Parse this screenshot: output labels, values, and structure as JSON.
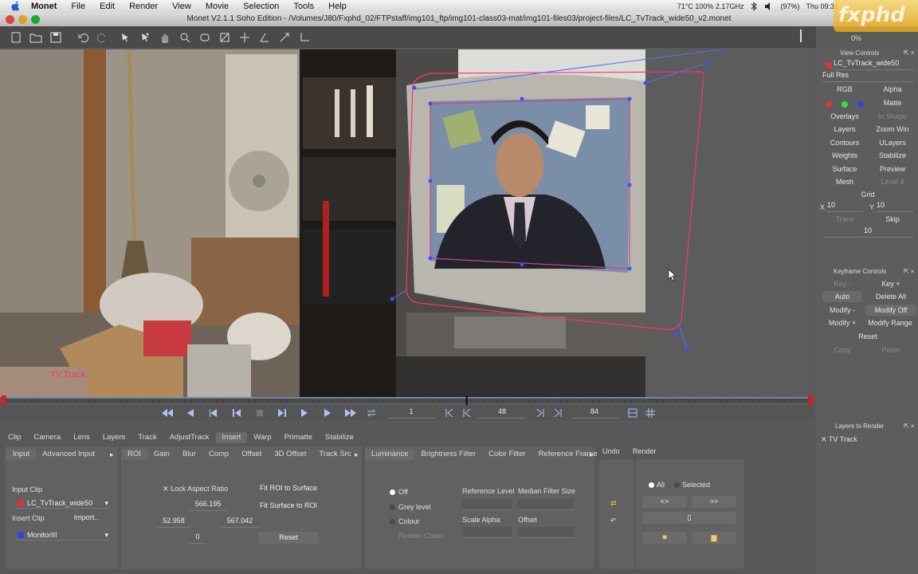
{
  "menubar": {
    "items": [
      "Monet",
      "File",
      "Edit",
      "Render",
      "View",
      "Movie",
      "Selection",
      "Tools",
      "Help"
    ],
    "status": "71°C 100% 2.17GHz",
    "battery": "(97%)",
    "clock": "Thu 09:31"
  },
  "window": {
    "title": "Monet V2.1.1 Soho Edition - /Volumes/J80/Fxphd_02/FTPstaff/img101_ftp/img101-class03-mat/img101-files03/project-files/LC_TvTrack_wide50_v2.monet",
    "watermark": "fxphd"
  },
  "toolbar": {
    "progress_label": "0%",
    "progress_value": 0
  },
  "viewer": {
    "layer_label": "TV Track",
    "accent_spline": "#ff3366",
    "accent_points": "#3355ff"
  },
  "view_controls": {
    "header": "View Controls",
    "clip": "LC_TvTrack_wide50",
    "resolution": "Full Res",
    "rgb": "RGB",
    "alpha": "Alpha",
    "matte": "Matte",
    "overlays": "Overlays",
    "in_shape": "In Shape",
    "layers": "Layers",
    "zoom_win": "Zoom Win",
    "contours": "Contours",
    "ulayers": "ULayers",
    "weights": "Weights",
    "stabilize": "Stabilize",
    "surface": "Surface",
    "preview": "Preview",
    "mesh": "Mesh",
    "level": "Level 4",
    "grid": "Grid",
    "grid_x_label": "X",
    "grid_x": "10",
    "grid_y_label": "Y",
    "grid_y": "10",
    "trace": "Trace",
    "skip": "Skip",
    "skip_value": "10"
  },
  "keyframe_controls": {
    "header": "Keyframe Controls",
    "key_minus": "Key -",
    "key_plus": "Key +",
    "auto": "Auto",
    "delete_all": "Delete All",
    "modify_minus": "Modify -",
    "modify_off": "Modify Off",
    "modify_plus": "Modify +",
    "modify_range": "Modify Range",
    "reset": "Reset",
    "copy": "Copy",
    "paste": "Paste"
  },
  "layers_to_render": {
    "header": "Layers to Render",
    "items": [
      "TV Track"
    ]
  },
  "transport": {
    "start_frame": "1",
    "current_frame": "48",
    "end_frame": "84",
    "playhead_fraction": 0.574
  },
  "tabs": {
    "main": [
      "Clip",
      "Camera",
      "Lens",
      "Layers",
      "Track",
      "AdjustTrack",
      "Insert",
      "Warp",
      "Primatte",
      "Stabilize"
    ],
    "main_active": 6,
    "input": [
      "Input",
      "Advanced Input"
    ],
    "roi": [
      "ROI",
      "Gain",
      "Blur",
      "Comp",
      "Offset",
      "3D Offset",
      "Track Src"
    ],
    "lum": [
      "Luminance",
      "Brightness Filter",
      "Color Filter",
      "Reference Frame"
    ],
    "undo": "Undo",
    "render": "Render"
  },
  "insert_input": {
    "input_clip_label": "Input Clip",
    "input_clip": "LC_TvTrack_wide50",
    "insert_clip_label": "Insert Clip",
    "import": "Import..",
    "insert_clip": "MonitorIII"
  },
  "roi": {
    "lock_aspect": "Lock Aspect Ratio",
    "fit_roi": "Fit ROI to Surface",
    "fit_surface": "Fit Surface to ROI",
    "top": "566.195",
    "left": "52.958",
    "right": "567.042",
    "bottom": "0",
    "reset": "Reset"
  },
  "luminance": {
    "off": "Off",
    "grey_level": "Grey level",
    "colour": "Colour",
    "render_chain": "Render Chain",
    "reference_level": "Reference Level",
    "median_filter": "Median Filter Size",
    "scale_alpha": "Scale Alpha",
    "offset": "Offset"
  },
  "render": {
    "all": "All",
    "selected": "Selected"
  }
}
